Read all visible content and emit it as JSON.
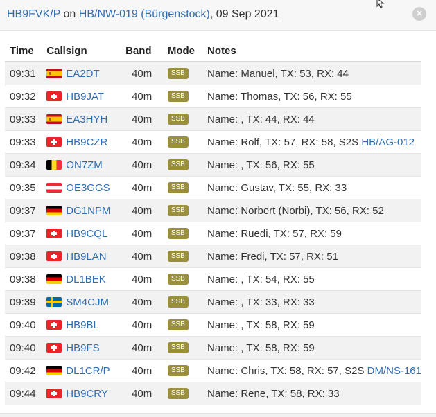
{
  "header": {
    "activator": "HB9FVK/P",
    "on_text": " on ",
    "summit": "HB/NW-019 (Bürgenstock)",
    "date_text": ", 09 Sep 2021",
    "close_icon": "close-icon"
  },
  "columns": {
    "time": "Time",
    "callsign": "Callsign",
    "band": "Band",
    "mode": "Mode",
    "notes": "Notes"
  },
  "colors": {
    "link": "#2f6db3",
    "badge": "#9a8f3a",
    "stripe": "#f2f2f2"
  },
  "rows": [
    {
      "time": "09:31",
      "flag": "es",
      "call": "EA2DT",
      "band": "40m",
      "mode": "SSB",
      "notes": "Name: Manuel, TX: 53, RX: 44",
      "s2s": ""
    },
    {
      "time": "09:32",
      "flag": "ch",
      "call": "HB9JAT",
      "band": "40m",
      "mode": "SSB",
      "notes": "Name: Thomas, TX: 56, RX: 55",
      "s2s": ""
    },
    {
      "time": "09:33",
      "flag": "es",
      "call": "EA3HYH",
      "band": "40m",
      "mode": "SSB",
      "notes": "Name: , TX: 44, RX: 44",
      "s2s": ""
    },
    {
      "time": "09:33",
      "flag": "ch",
      "call": "HB9CZR",
      "band": "40m",
      "mode": "SSB",
      "notes": "Name: Rolf, TX: 57, RX: 58, S2S ",
      "s2s": "HB/AG-012"
    },
    {
      "time": "09:34",
      "flag": "be",
      "call": "ON7ZM",
      "band": "40m",
      "mode": "SSB",
      "notes": "Name: , TX: 56, RX: 55",
      "s2s": ""
    },
    {
      "time": "09:35",
      "flag": "at",
      "call": "OE3GGS",
      "band": "40m",
      "mode": "SSB",
      "notes": "Name: Gustav, TX: 55, RX: 33",
      "s2s": ""
    },
    {
      "time": "09:37",
      "flag": "de",
      "call": "DG1NPM",
      "band": "40m",
      "mode": "SSB",
      "notes": "Name: Norbert (Norbi), TX: 56, RX: 52",
      "s2s": ""
    },
    {
      "time": "09:37",
      "flag": "ch",
      "call": "HB9CQL",
      "band": "40m",
      "mode": "SSB",
      "notes": "Name: Ruedi, TX: 57, RX: 59",
      "s2s": ""
    },
    {
      "time": "09:38",
      "flag": "ch",
      "call": "HB9LAN",
      "band": "40m",
      "mode": "SSB",
      "notes": "Name: Fredi, TX: 57, RX: 51",
      "s2s": ""
    },
    {
      "time": "09:38",
      "flag": "de",
      "call": "DL1BEK",
      "band": "40m",
      "mode": "SSB",
      "notes": "Name: , TX: 54, RX: 55",
      "s2s": ""
    },
    {
      "time": "09:39",
      "flag": "se",
      "call": "SM4CJM",
      "band": "40m",
      "mode": "SSB",
      "notes": "Name: , TX: 33, RX: 33",
      "s2s": ""
    },
    {
      "time": "09:40",
      "flag": "ch",
      "call": "HB9BL",
      "band": "40m",
      "mode": "SSB",
      "notes": "Name: , TX: 58, RX: 59",
      "s2s": ""
    },
    {
      "time": "09:40",
      "flag": "ch",
      "call": "HB9FS",
      "band": "40m",
      "mode": "SSB",
      "notes": "Name: , TX: 58, RX: 59",
      "s2s": ""
    },
    {
      "time": "09:42",
      "flag": "de",
      "call": "DL1CR/P",
      "band": "40m",
      "mode": "SSB",
      "notes": "Name: Chris, TX: 58, RX: 57, S2S ",
      "s2s": "DM/NS-161"
    },
    {
      "time": "09:44",
      "flag": "ch",
      "call": "HB9CRY",
      "band": "40m",
      "mode": "SSB",
      "notes": "Name: Rene, TX: 58, RX: 33",
      "s2s": ""
    }
  ]
}
